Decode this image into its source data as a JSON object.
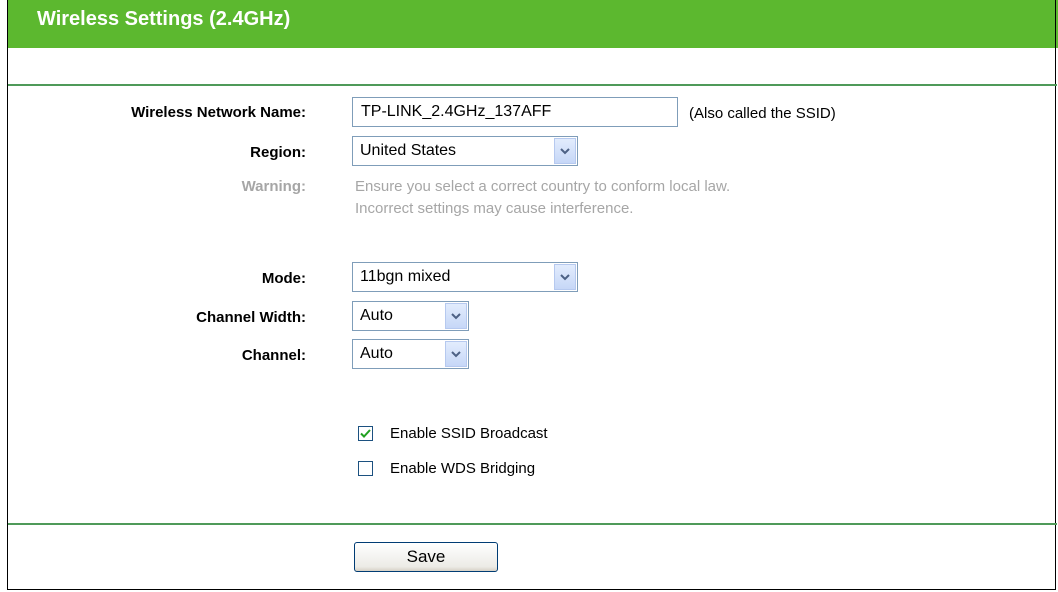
{
  "page": {
    "title": "Wireless Settings (2.4GHz)"
  },
  "form": {
    "ssid": {
      "label": "Wireless Network Name:",
      "value": "TP-LINK_2.4GHz_137AFF",
      "note": "(Also called the SSID)"
    },
    "region": {
      "label": "Region:",
      "value": "United States"
    },
    "warning": {
      "label": "Warning:",
      "line1": "Ensure you select a correct country to conform local law.",
      "line2": "Incorrect settings may cause interference."
    },
    "mode": {
      "label": "Mode:",
      "value": "11bgn mixed"
    },
    "channel_width": {
      "label": "Channel Width:",
      "value": "Auto"
    },
    "channel": {
      "label": "Channel:",
      "value": "Auto"
    },
    "ssid_broadcast": {
      "label": "Enable SSID Broadcast",
      "checked": true
    },
    "wds_bridging": {
      "label": "Enable WDS Bridging",
      "checked": false
    }
  },
  "actions": {
    "save_label": "Save"
  },
  "colors": {
    "header_bg": "#5cb82f",
    "rule": "#4f9a59",
    "muted_text": "#a6a6a6"
  }
}
